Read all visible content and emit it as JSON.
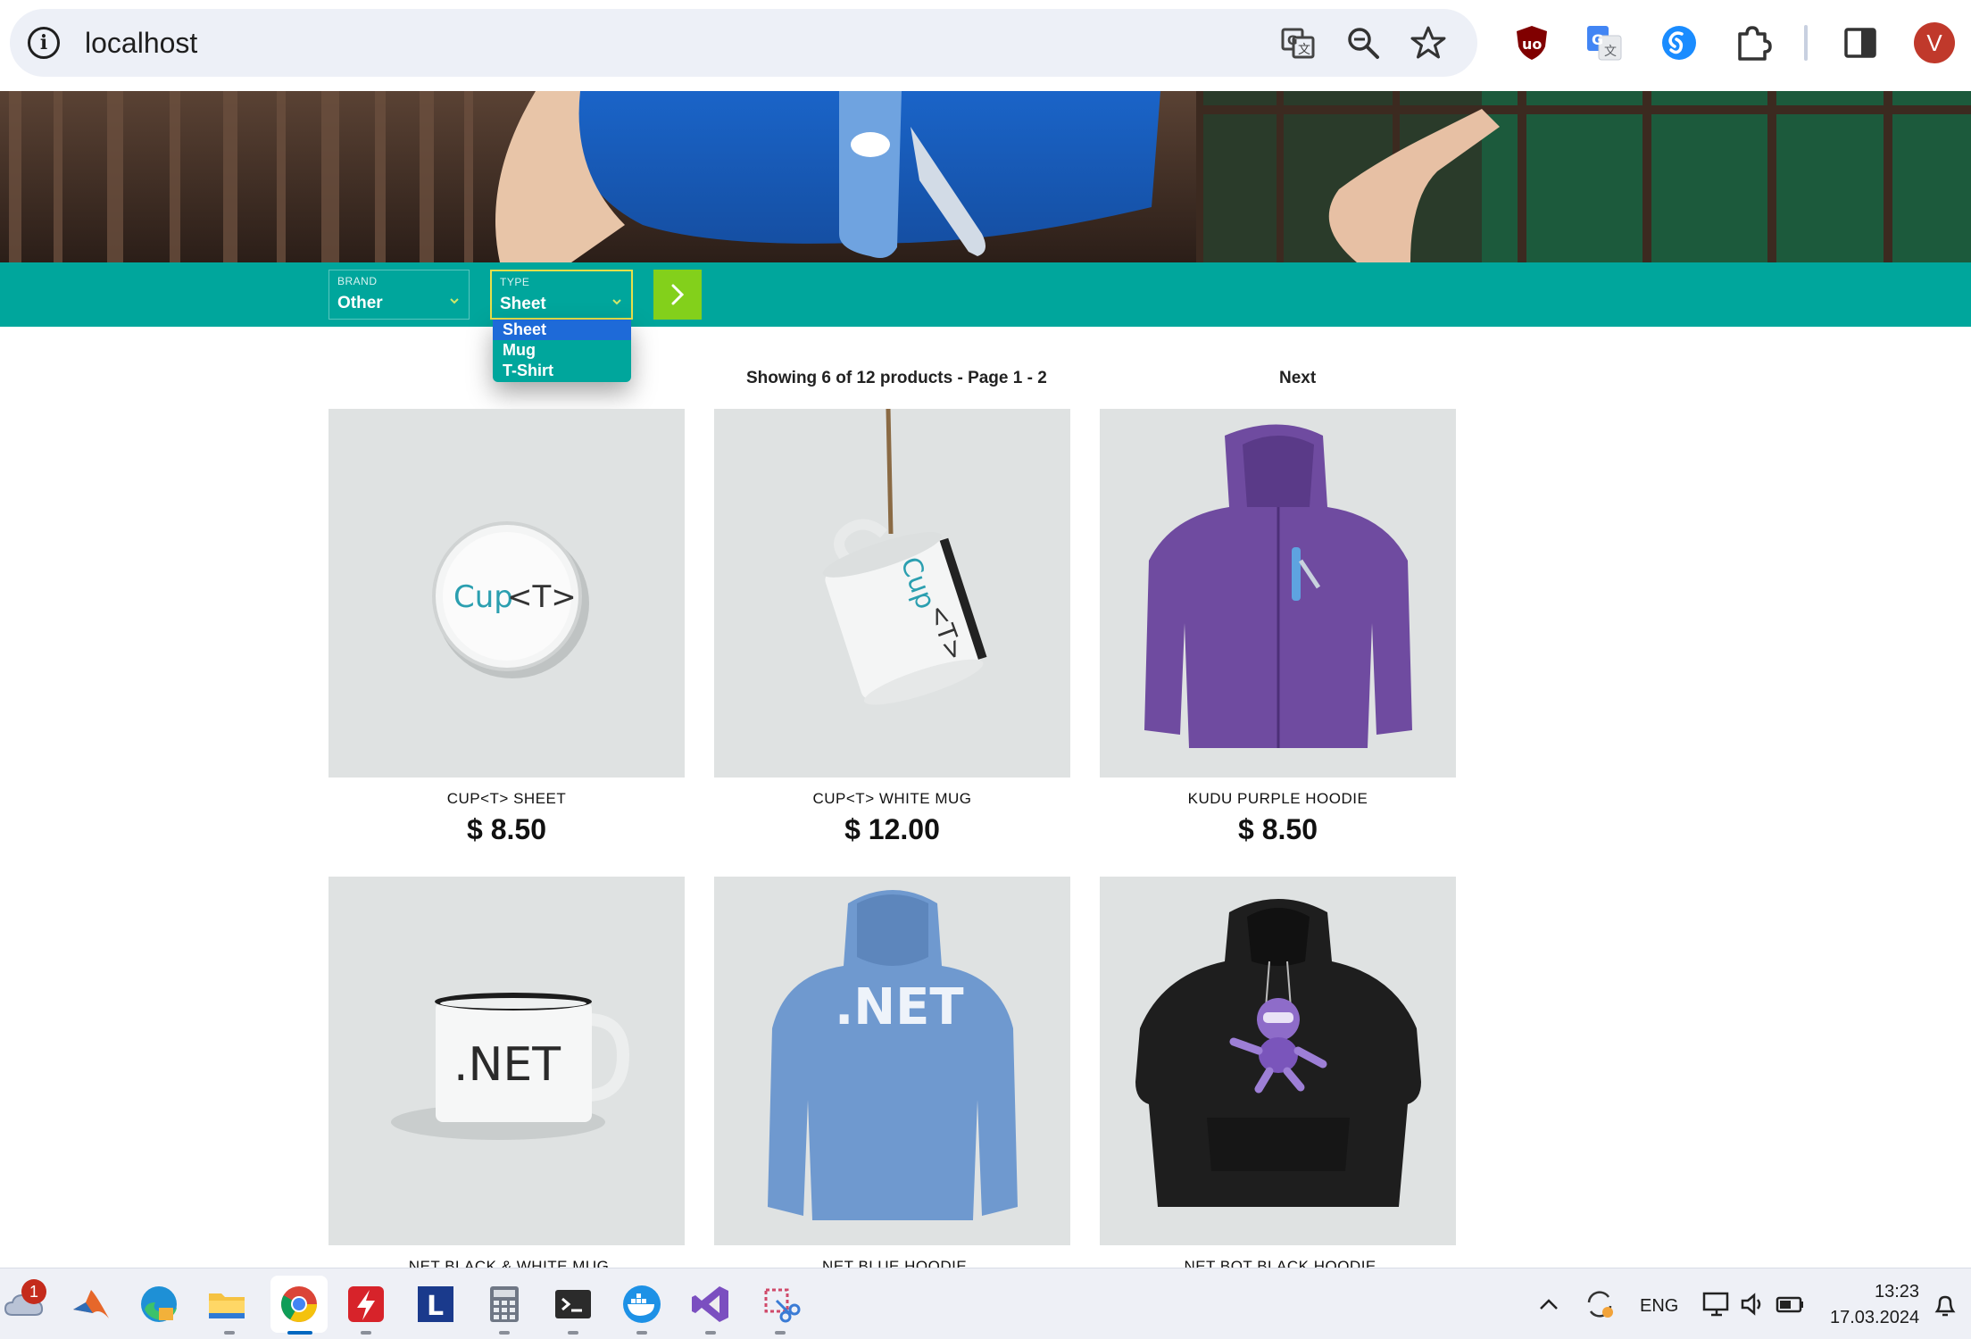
{
  "browser": {
    "url": "localhost",
    "avatar_letter": "V",
    "omnibox_icons": [
      "translate-icon",
      "zoom-out-icon",
      "bookmark-star-icon"
    ],
    "extension_icons": [
      "ublock-icon",
      "google-translate-icon",
      "shazam-icon",
      "extensions-puzzle-icon",
      "side-panel-icon"
    ],
    "accent_avatar": "#c0392b"
  },
  "filters": {
    "brand": {
      "label": "BRAND",
      "value": "Other"
    },
    "type": {
      "label": "TYPE",
      "value": "Sheet",
      "options": [
        "Sheet",
        "Mug",
        "T-Shirt"
      ],
      "highlighted": "Sheet"
    },
    "apply_icon": "chevron-right-icon",
    "bar_color": "#00a69c",
    "button_color": "#83d01b"
  },
  "catalog": {
    "pager_info": "Showing 6 of 12 products - Page 1 - 2",
    "next_label": "Next",
    "products": [
      {
        "name": "CUP<T> SHEET",
        "price": "$ 8.50",
        "image": "cup-t-button-badge",
        "image_text": "Cup<T>"
      },
      {
        "name": "CUP<T> WHITE MUG",
        "price": "$ 12.00",
        "image": "cup-t-hanging-mug",
        "image_text": "Cup<T>"
      },
      {
        "name": "KUDU PURPLE HOODIE",
        "price": "$ 8.50",
        "image": "purple-hoodie"
      },
      {
        "name": ".NET BLACK & WHITE MUG",
        "price": "",
        "image": "net-white-mug",
        "image_text": ".NET"
      },
      {
        "name": ".NET BLUE HOODIE",
        "price": "",
        "image": "net-blue-hoodie",
        "image_text": ".NET"
      },
      {
        "name": ".NET BOT BLACK HOODIE",
        "price": "",
        "image": "netbot-black-hoodie"
      }
    ]
  },
  "taskbar": {
    "apps": [
      "onedrive-icon",
      "matlab-icon",
      "edge-icon",
      "file-explorer-icon",
      "chrome-icon",
      "acrobat-icon",
      "l-app-icon",
      "calculator-icon",
      "terminal-icon",
      "docker-icon",
      "visual-studio-icon",
      "snipping-tool-icon"
    ],
    "onedrive_badge": "1",
    "language": "ENG",
    "time": "13:23",
    "date": "17.03.2024"
  }
}
